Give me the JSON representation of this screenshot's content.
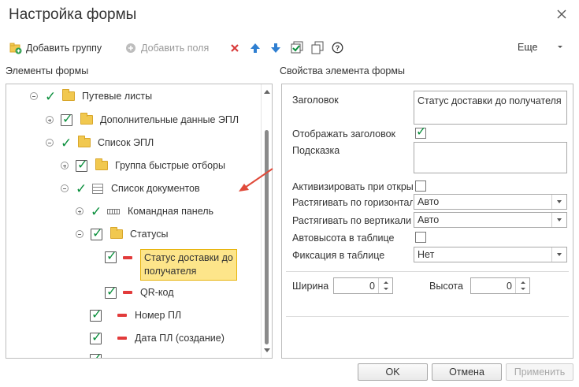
{
  "window": {
    "title": "Настройка формы",
    "close_icon": "close-icon"
  },
  "toolbar": {
    "add_group": "Добавить группу",
    "add_fields": "Добавить поля",
    "more": "Еще",
    "icons": [
      "delete-icon",
      "move-up-icon",
      "move-down-icon",
      "check-all-icon",
      "copy-icon",
      "help-icon"
    ],
    "colors": {
      "delete": "#d83b3b",
      "arrow": "#2f7fd1",
      "check": "#0a8f3c"
    }
  },
  "left_panel": {
    "label": "Элементы формы",
    "tree": [
      {
        "label": "Путевые листы",
        "expander": "minus",
        "mark": "tick",
        "icon": "folder-icon"
      },
      {
        "label": "Дополнительные данные ЭПЛ",
        "expander": "plus",
        "mark": "checkbox",
        "icon": "folder-icon"
      },
      {
        "label": "Список ЭПЛ",
        "expander": "minus",
        "mark": "tick",
        "icon": "folder-icon"
      },
      {
        "label": "Группа быстрые отборы",
        "expander": "plus",
        "mark": "checkbox",
        "icon": "folder-icon"
      },
      {
        "label": "Список документов",
        "expander": "minus",
        "mark": "tick",
        "icon": "table-icon"
      },
      {
        "label": "Командная панель",
        "expander": "plus",
        "mark": "tick",
        "icon": "command-bar-icon"
      },
      {
        "label": "Статусы",
        "expander": "minus",
        "mark": "checkbox",
        "icon": "folder-icon"
      },
      {
        "label_line1": "Статус доставки до",
        "label_line2": "получателя",
        "mark": "checkbox",
        "icon": "field-icon",
        "selected": true
      },
      {
        "label": "QR-код",
        "mark": "checkbox",
        "icon": "field-icon"
      },
      {
        "label": "Номер ПЛ",
        "mark": "checkbox",
        "icon": "field-icon"
      },
      {
        "label": "Дата ПЛ (создание)",
        "mark": "checkbox",
        "icon": "field-icon"
      }
    ]
  },
  "right_panel": {
    "label": "Свойства элемента формы",
    "header_label": "Заголовок",
    "header_value": "Статус доставки до получателя",
    "show_header_label": "Отображать заголовок",
    "show_header_checked": true,
    "hint_label": "Подсказка",
    "hint_value": "",
    "activate_label": "Активизировать при откры",
    "activate_checked": false,
    "stretch_h_label": "Растягивать по горизонтал",
    "stretch_h_value": "Авто",
    "stretch_v_label": "Растягивать по вертикали",
    "stretch_v_value": "Авто",
    "autoheight_label": "Автовысота в таблице",
    "autoheight_checked": false,
    "fix_label": "Фиксация в таблице",
    "fix_value": "Нет",
    "width_label": "Ширина",
    "width_value": "0",
    "height_label": "Высота",
    "height_value": "0"
  },
  "footer": {
    "ok": "OK",
    "cancel": "Отмена",
    "apply": "Применить"
  },
  "accent": {
    "selection": "#fde58a",
    "selection_border": "#e7b40d",
    "annotation_arrow": "#e04a3a"
  }
}
